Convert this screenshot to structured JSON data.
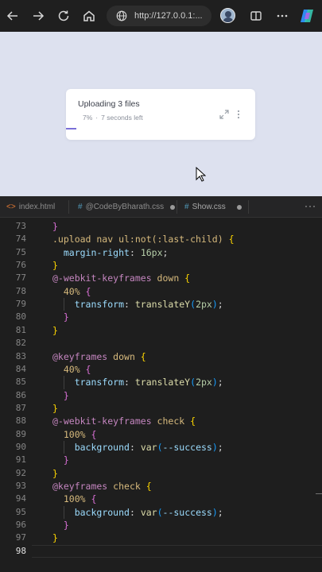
{
  "browser": {
    "url": "http://127.0.0.1:...",
    "icons": [
      "back-icon",
      "forward-icon",
      "refresh-icon",
      "home-icon",
      "globe-icon",
      "profile-avatar",
      "split-screen-icon",
      "more-icon",
      "copilot-icon"
    ]
  },
  "upload_card": {
    "title": "Uploading 3 files",
    "percent": "7%",
    "separator": "·",
    "time_left": "7 seconds left",
    "progress_fraction": 0.07
  },
  "editor": {
    "tabs": [
      {
        "icon": "<>",
        "label": "index.html"
      },
      {
        "icon": "#",
        "label": "@CodeByBharath.css"
      },
      {
        "icon": "#",
        "label": "Show.css"
      }
    ],
    "more": "···",
    "current_line": "98",
    "lines": [
      {
        "n": "73",
        "tokens": [
          {
            "t": "}",
            "c": "t-br-p"
          }
        ]
      },
      {
        "n": "74",
        "tokens": [
          {
            "t": ".upload nav ul:not(:last-child) ",
            "c": "t-sel"
          },
          {
            "t": "{",
            "c": "t-br-y"
          }
        ]
      },
      {
        "n": "75",
        "tokens": [
          {
            "t": "  ",
            "c": "t-plain"
          },
          {
            "t": "margin-right",
            "c": "t-prop"
          },
          {
            "t": ": ",
            "c": "t-plain"
          },
          {
            "t": "16px",
            "c": "t-num"
          },
          {
            "t": ";",
            "c": "t-plain"
          }
        ]
      },
      {
        "n": "76",
        "tokens": [
          {
            "t": "}",
            "c": "t-br-y"
          }
        ]
      },
      {
        "n": "77",
        "tokens": [
          {
            "t": "@-webkit-keyframes",
            "c": "t-kw"
          },
          {
            "t": " down ",
            "c": "t-sel"
          },
          {
            "t": "{",
            "c": "t-br-y"
          }
        ]
      },
      {
        "n": "78",
        "tokens": [
          {
            "t": "  40% ",
            "c": "t-sel"
          },
          {
            "t": "{",
            "c": "t-br-p"
          }
        ]
      },
      {
        "n": "79",
        "tokens": [
          {
            "t": "    ",
            "c": "t-plain"
          },
          {
            "t": "transform",
            "c": "t-prop"
          },
          {
            "t": ": ",
            "c": "t-plain"
          },
          {
            "t": "translateY",
            "c": "t-fn"
          },
          {
            "t": "(",
            "c": "t-br-b"
          },
          {
            "t": "2px",
            "c": "t-num"
          },
          {
            "t": ")",
            "c": "t-br-b"
          },
          {
            "t": ";",
            "c": "t-plain"
          }
        ]
      },
      {
        "n": "80",
        "tokens": [
          {
            "t": "  ",
            "c": "t-plain"
          },
          {
            "t": "}",
            "c": "t-br-p"
          }
        ]
      },
      {
        "n": "81",
        "tokens": [
          {
            "t": "}",
            "c": "t-br-y"
          }
        ]
      },
      {
        "n": "82",
        "tokens": []
      },
      {
        "n": "83",
        "tokens": [
          {
            "t": "@keyframes",
            "c": "t-kw"
          },
          {
            "t": " down ",
            "c": "t-sel"
          },
          {
            "t": "{",
            "c": "t-br-y"
          }
        ]
      },
      {
        "n": "84",
        "tokens": [
          {
            "t": "  40% ",
            "c": "t-sel"
          },
          {
            "t": "{",
            "c": "t-br-p"
          }
        ]
      },
      {
        "n": "85",
        "tokens": [
          {
            "t": "    ",
            "c": "t-plain"
          },
          {
            "t": "transform",
            "c": "t-prop"
          },
          {
            "t": ": ",
            "c": "t-plain"
          },
          {
            "t": "translateY",
            "c": "t-fn"
          },
          {
            "t": "(",
            "c": "t-br-b"
          },
          {
            "t": "2px",
            "c": "t-num"
          },
          {
            "t": ")",
            "c": "t-br-b"
          },
          {
            "t": ";",
            "c": "t-plain"
          }
        ]
      },
      {
        "n": "86",
        "tokens": [
          {
            "t": "  ",
            "c": "t-plain"
          },
          {
            "t": "}",
            "c": "t-br-p"
          }
        ]
      },
      {
        "n": "87",
        "tokens": [
          {
            "t": "}",
            "c": "t-br-y"
          }
        ]
      },
      {
        "n": "88",
        "tokens": [
          {
            "t": "@-webkit-keyframes",
            "c": "t-kw"
          },
          {
            "t": " check ",
            "c": "t-sel"
          },
          {
            "t": "{",
            "c": "t-br-y"
          }
        ]
      },
      {
        "n": "89",
        "tokens": [
          {
            "t": "  100% ",
            "c": "t-sel"
          },
          {
            "t": "{",
            "c": "t-br-p"
          }
        ]
      },
      {
        "n": "90",
        "tokens": [
          {
            "t": "    ",
            "c": "t-plain"
          },
          {
            "t": "background",
            "c": "t-prop"
          },
          {
            "t": ": ",
            "c": "t-plain"
          },
          {
            "t": "var",
            "c": "t-fn"
          },
          {
            "t": "(",
            "c": "t-br-b"
          },
          {
            "t": "--success",
            "c": "t-var"
          },
          {
            "t": ")",
            "c": "t-br-b"
          },
          {
            "t": ";",
            "c": "t-plain"
          }
        ]
      },
      {
        "n": "91",
        "tokens": [
          {
            "t": "  ",
            "c": "t-plain"
          },
          {
            "t": "}",
            "c": "t-br-p"
          }
        ]
      },
      {
        "n": "92",
        "tokens": [
          {
            "t": "}",
            "c": "t-br-y"
          }
        ]
      },
      {
        "n": "93",
        "tokens": [
          {
            "t": "@keyframes",
            "c": "t-kw"
          },
          {
            "t": " check ",
            "c": "t-sel"
          },
          {
            "t": "{",
            "c": "t-br-y"
          }
        ]
      },
      {
        "n": "94",
        "tokens": [
          {
            "t": "  100% ",
            "c": "t-sel"
          },
          {
            "t": "{",
            "c": "t-br-p"
          }
        ]
      },
      {
        "n": "95",
        "tokens": [
          {
            "t": "    ",
            "c": "t-plain"
          },
          {
            "t": "background",
            "c": "t-prop"
          },
          {
            "t": ": ",
            "c": "t-plain"
          },
          {
            "t": "var",
            "c": "t-fn"
          },
          {
            "t": "(",
            "c": "t-br-b"
          },
          {
            "t": "--success",
            "c": "t-var"
          },
          {
            "t": ")",
            "c": "t-br-b"
          },
          {
            "t": ";",
            "c": "t-plain"
          }
        ]
      },
      {
        "n": "96",
        "tokens": [
          {
            "t": "  ",
            "c": "t-plain"
          },
          {
            "t": "}",
            "c": "t-br-p"
          }
        ]
      },
      {
        "n": "97",
        "tokens": [
          {
            "t": "}",
            "c": "t-br-y"
          }
        ]
      },
      {
        "n": "98",
        "tokens": []
      }
    ]
  },
  "colors": {
    "page_background": "#dde1ef",
    "progress": "#7a6fd8",
    "editor_background": "#1e1e1e"
  }
}
